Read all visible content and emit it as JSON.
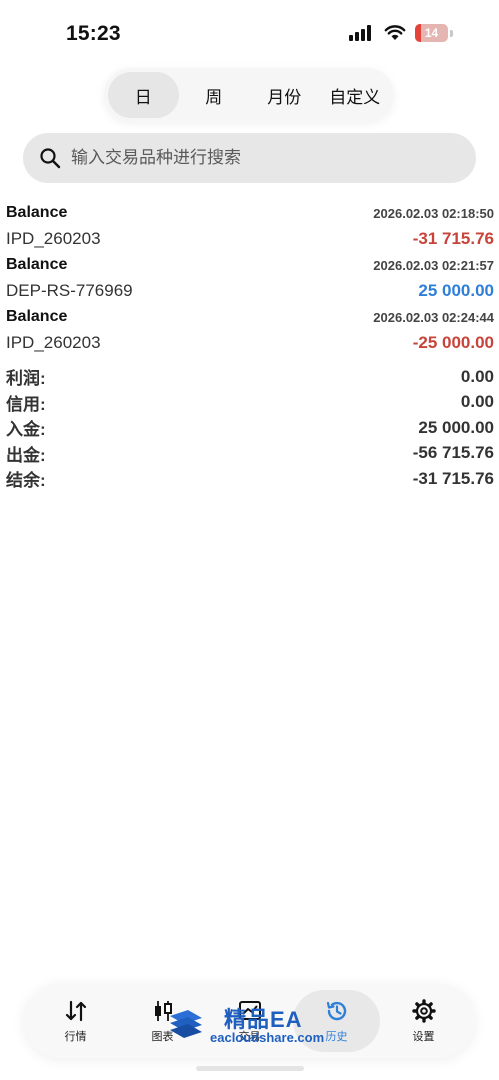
{
  "status_bar": {
    "time": "15:23",
    "battery": "14"
  },
  "period_tabs": [
    {
      "label": "日",
      "active": true
    },
    {
      "label": "周",
      "active": false
    },
    {
      "label": "月份",
      "active": false
    },
    {
      "label": "自定义",
      "active": false
    }
  ],
  "search": {
    "placeholder": "输入交易品种进行搜索",
    "value": ""
  },
  "records": [
    {
      "type": "Balance",
      "id": "IPD_260203",
      "time": "2026.02.03 02:18:50",
      "amount": "-31 715.76"
    },
    {
      "type": "Balance",
      "id": "DEP-RS-776969",
      "time": "2026.02.03 02:21:57",
      "amount": "25 000.00"
    },
    {
      "type": "Balance",
      "id": "IPD_260203",
      "time": "2026.02.03 02:24:44",
      "amount": "-25 000.00"
    }
  ],
  "summary": [
    {
      "label": "利润:",
      "value": "0.00"
    },
    {
      "label": "信用:",
      "value": "0.00"
    },
    {
      "label": "入金:",
      "value": "25 000.00"
    },
    {
      "label": "出金:",
      "value": "-56 715.76"
    },
    {
      "label": "结余:",
      "value": "-31 715.76"
    }
  ],
  "tabbar": [
    {
      "label": "行情",
      "icon": "arrows-updown-icon",
      "active": false
    },
    {
      "label": "图表",
      "icon": "candlestick-icon",
      "active": false
    },
    {
      "label": "交易",
      "icon": "trade-chart-icon",
      "active": false
    },
    {
      "label": "历史",
      "icon": "history-clock-icon",
      "active": true
    },
    {
      "label": "设置",
      "icon": "gear-icon",
      "active": false
    }
  ],
  "watermark": {
    "title": "精品EA",
    "subtitle": "eacloudshare.com"
  },
  "colors": {
    "negative": "#c8443a",
    "positive": "#2f7fd8",
    "active_tab": "#2f7fd8"
  }
}
